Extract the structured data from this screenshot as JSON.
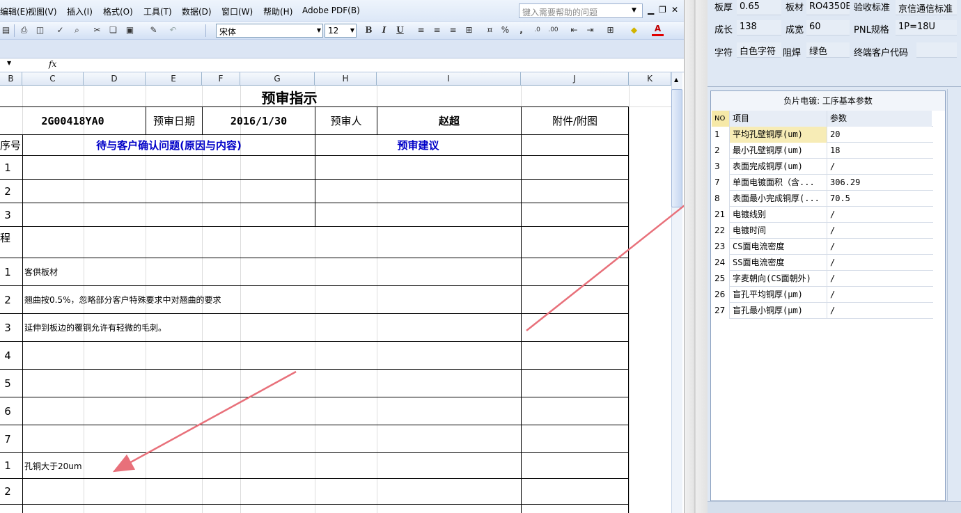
{
  "menu": {
    "items": [
      "编辑(E)",
      "视图(V)",
      "插入(I)",
      "格式(O)",
      "工具(T)",
      "数据(D)",
      "窗口(W)",
      "帮助(H)",
      "Adobe PDF(B)"
    ],
    "help_placeholder": "键入需要帮助的问题"
  },
  "toolbar": {
    "font_name": "宋体",
    "font_size": "12",
    "bold": "B",
    "italic": "I",
    "underline": "U",
    "percent": "%",
    "comma": ",",
    "font_color": "A"
  },
  "formula_bar": {
    "fx": "fx",
    "value": ""
  },
  "columns": [
    "B",
    "C",
    "D",
    "E",
    "F",
    "G",
    "H",
    "I",
    "J",
    "K"
  ],
  "sheet": {
    "title": "预审指示",
    "header": {
      "part_no": "2G00418YA0",
      "date_label": "预审日期",
      "date": "2016/1/30",
      "reviewer_label": "预审人",
      "reviewer": "赵超",
      "attachment_label": "附件/附图"
    },
    "seq_label": "序号",
    "questions_label": "待与客户确认问题(原因与内容)",
    "suggestion_label": "预审建议",
    "q_rows": [
      "1",
      "2",
      "3"
    ],
    "process_label": "程",
    "notes": [
      {
        "no": "1",
        "text": "客供板材"
      },
      {
        "no": "2",
        "text": "翘曲按0.5%，忽略部分客户特殊要求中对翘曲的要求"
      },
      {
        "no": "3",
        "text": "延伸到板边的覆铜允许有轻微的毛刺。"
      },
      {
        "no": "4",
        "text": ""
      },
      {
        "no": "5",
        "text": ""
      },
      {
        "no": "6",
        "text": ""
      },
      {
        "no": "7",
        "text": ""
      }
    ],
    "extra": [
      {
        "no": "1",
        "text": "孔铜大于20um"
      },
      {
        "no": "2",
        "text": ""
      }
    ]
  },
  "right_panel": {
    "fields": [
      {
        "label": "板厚",
        "value": "0.65"
      },
      {
        "label": "板材",
        "value": "RO4350B"
      },
      {
        "label": "验收标准",
        "value": "京信通信标准"
      },
      {
        "label": "成长",
        "value": "138"
      },
      {
        "label": "成宽",
        "value": "60"
      },
      {
        "label": "PNL规格",
        "value": "1P=18U"
      },
      {
        "label": "字符",
        "value": "白色字符"
      },
      {
        "label": "阻焊",
        "value": "绿色"
      },
      {
        "label": "终端客户代码",
        "value": ""
      }
    ],
    "param_title": "负片电镀: 工序基本参数",
    "param_headers": [
      "NO",
      "项目",
      "参数"
    ],
    "params": [
      {
        "no": "1",
        "item": "平均孔壁铜厚(um)",
        "value": "20"
      },
      {
        "no": "2",
        "item": "最小孔壁铜厚(um)",
        "value": "18"
      },
      {
        "no": "3",
        "item": "表面完成铜厚(um)",
        "value": "/"
      },
      {
        "no": "7",
        "item": "单面电镀面积（含...",
        "value": "306.29"
      },
      {
        "no": "8",
        "item": "表面最小完成铜厚(...",
        "value": "70.5"
      },
      {
        "no": "21",
        "item": "电镀线别",
        "value": "/"
      },
      {
        "no": "22",
        "item": "电镀时间",
        "value": "/"
      },
      {
        "no": "23",
        "item": "CS面电流密度",
        "value": "/"
      },
      {
        "no": "24",
        "item": "SS面电流密度",
        "value": "/"
      },
      {
        "no": "25",
        "item": "字麦朝向(CS面朝外)",
        "value": "/"
      },
      {
        "no": "26",
        "item": "盲孔平均铜厚(μm)",
        "value": "/"
      },
      {
        "no": "27",
        "item": "盲孔最小铜厚(μm)",
        "value": "/"
      }
    ]
  },
  "colors": {
    "accent_blue": "#0000c8",
    "annotation_arrow": "#e8707a"
  }
}
